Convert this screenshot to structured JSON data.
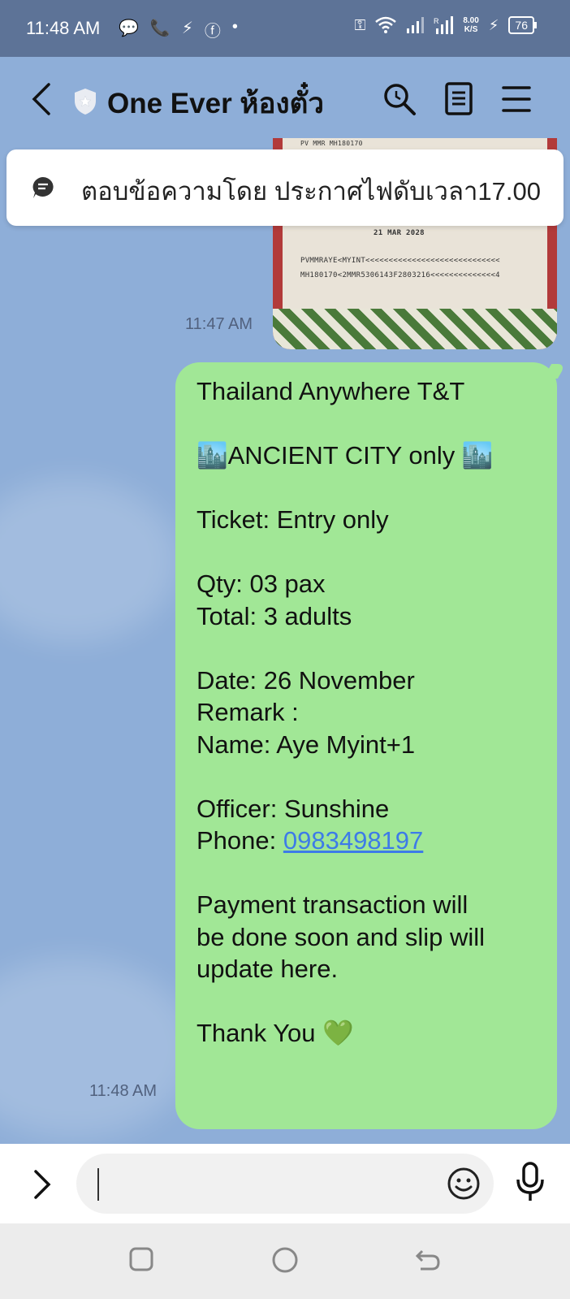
{
  "status_bar": {
    "time": "11:48 AM",
    "speed_value": "8.00",
    "speed_unit": "K/S",
    "battery": "76"
  },
  "header": {
    "title": "One Ever ห้องตั๋ว"
  },
  "pinned": {
    "text": "ตอบข้อความโดย ประกาศไฟดับเวลา17.00"
  },
  "photo_message": {
    "timestamp": "11:47 AM",
    "date_text": "21 MAR 2028",
    "mrz_line1": "PVMMRAYE<MYINT<<<<<<<<<<<<<<<<<<<<<<<<<<<<<",
    "mrz_line2": "MH180170<2MMR5306143F2803216<<<<<<<<<<<<<<4",
    "top_labels": "PV        MMR                              MH180170"
  },
  "message": {
    "timestamp": "11:48 AM",
    "lines": [
      "Thailand Anywhere T&T",
      "",
      "🏙️ANCIENT CITY only 🏙️",
      "",
      "Ticket: Entry only",
      "",
      "Qty: 03 pax",
      "Total: 3 adults",
      "",
      "Date: 26 November",
      "Remark :",
      "Name: Aye Myint+1",
      "",
      "Officer: Sunshine"
    ],
    "phone_label": "Phone: ",
    "phone_number": "0983498197",
    "lines_after": [
      "",
      "Payment transaction will",
      "be done soon and slip will",
      "update here.",
      "",
      "Thank You 💚"
    ]
  },
  "input": {
    "placeholder": ""
  },
  "colors": {
    "chat_bg": "#8eaed8",
    "bubble": "#a1e796",
    "status_bar": "#5d7397",
    "link": "#3d7be8"
  }
}
